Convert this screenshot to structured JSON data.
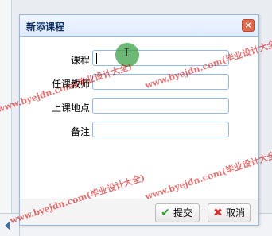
{
  "dialog": {
    "title": "新添课程",
    "close_symbol": "×"
  },
  "form": {
    "fields": [
      {
        "label": "课程",
        "value": ""
      },
      {
        "label": "任课教师",
        "value": ""
      },
      {
        "label": "上课地点",
        "value": ""
      },
      {
        "label": "备注",
        "value": ""
      }
    ]
  },
  "buttons": {
    "submit": "提交",
    "cancel": "取消"
  },
  "icons": {
    "submit": "check-icon",
    "cancel": "cross-icon",
    "close": "close-icon",
    "pager_prev": "triangle-left-icon"
  },
  "watermark": {
    "text": "www.byejdn.com(毕业设计大全)"
  }
}
